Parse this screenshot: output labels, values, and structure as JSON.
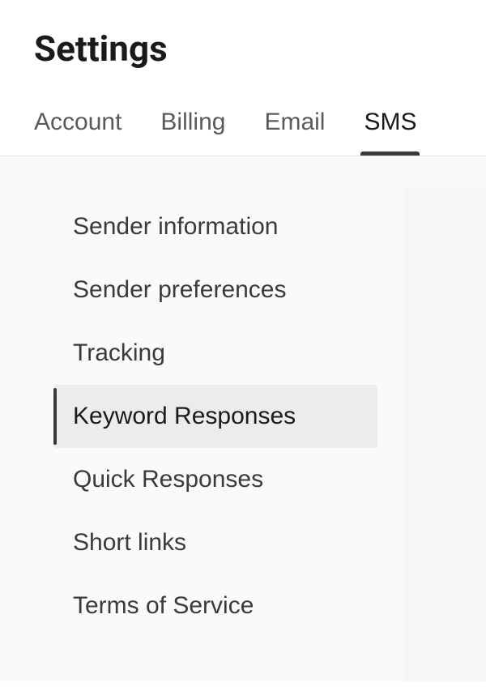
{
  "page": {
    "title": "Settings"
  },
  "tabs": {
    "items": [
      {
        "label": "Account",
        "active": false
      },
      {
        "label": "Billing",
        "active": false
      },
      {
        "label": "Email",
        "active": false
      },
      {
        "label": "SMS",
        "active": true
      }
    ]
  },
  "sidebar": {
    "items": [
      {
        "label": "Sender information",
        "active": false
      },
      {
        "label": "Sender preferences",
        "active": false
      },
      {
        "label": "Tracking",
        "active": false
      },
      {
        "label": "Keyword Responses",
        "active": true
      },
      {
        "label": "Quick Responses",
        "active": false
      },
      {
        "label": "Short links",
        "active": false
      },
      {
        "label": "Terms of Service",
        "active": false
      }
    ]
  }
}
